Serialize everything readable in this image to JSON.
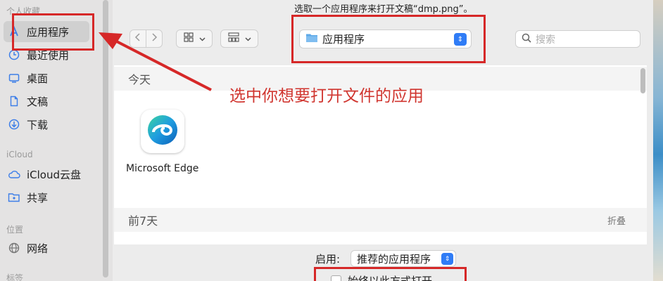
{
  "sidebar": {
    "favorites_title": "个人收藏",
    "icloud_title": "iCloud",
    "locations_title": "位置",
    "tags_title": "标签",
    "favorites": [
      {
        "label": "应用程序",
        "icon": "applications-icon"
      },
      {
        "label": "最近使用",
        "icon": "clock-icon"
      },
      {
        "label": "桌面",
        "icon": "desktop-icon"
      },
      {
        "label": "文稿",
        "icon": "document-icon"
      },
      {
        "label": "下载",
        "icon": "download-icon"
      }
    ],
    "icloud": [
      {
        "label": "iCloud云盘",
        "icon": "cloud-icon"
      },
      {
        "label": "共享",
        "icon": "shared-folder-icon"
      }
    ],
    "locations": [
      {
        "label": "网络",
        "icon": "globe-icon"
      }
    ]
  },
  "dialog": {
    "prompt": "选取一个应用程序来打开文稿“dmp.png”。"
  },
  "toolbar": {
    "back_icon": "chevron-left-icon",
    "forward_icon": "chevron-right-icon",
    "view_icon": "grid-view-icon",
    "group_icon": "group-view-icon",
    "location": "应用程序",
    "search_placeholder": "搜索"
  },
  "content": {
    "group_today": "今天",
    "group_prev7": "前7天",
    "collapse": "折叠",
    "apps": [
      {
        "name": "Microsoft Edge",
        "icon": "edge-icon"
      }
    ]
  },
  "footer": {
    "enable_label": "启用:",
    "enable_value": "推荐的应用程序",
    "always_open": "始终以此方式打开"
  },
  "annotation": {
    "text": "选中你想要打开文件的应用",
    "color": "#d62828"
  },
  "colors": {
    "accent": "#2f7cf6"
  }
}
